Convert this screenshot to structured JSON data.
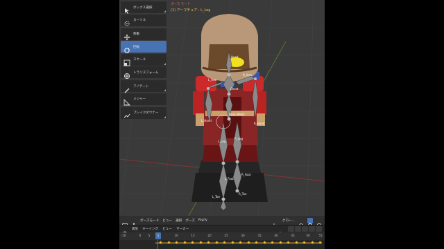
{
  "viewport": {
    "mode_text": "ポーズ モード",
    "object_text": "(1) アーマチュア : L_Leg"
  },
  "toolbar": {
    "items": [
      {
        "label": "ボックス選択",
        "icon": "box-select-icon",
        "active": false
      },
      {
        "label": "カーソル",
        "icon": "cursor-icon",
        "active": false
      },
      {
        "label": "移動",
        "icon": "move-icon",
        "active": false
      },
      {
        "label": "回転",
        "icon": "rotate-icon",
        "active": true
      },
      {
        "label": "スケール",
        "icon": "scale-icon",
        "active": false
      },
      {
        "label": "トランスフォーム",
        "icon": "transform-icon",
        "active": false
      },
      {
        "label": "アノテート",
        "icon": "annotate-icon",
        "active": false
      },
      {
        "label": "メジャー",
        "icon": "measure-icon",
        "active": false
      },
      {
        "label": "ブレイクダウナー",
        "icon": "breakdowner-icon",
        "active": false
      }
    ]
  },
  "bones": {
    "head": "Head",
    "l_arm": "L_Arm",
    "r_arm": "R_Arm",
    "chest": "Chest",
    "waist": "Base_Waist",
    "l_hand": "L_Hand",
    "r_hand": "R_Hand",
    "l_leg": "L_Leg",
    "r_leg": "R_Leg",
    "l_foot": "L_Foot",
    "r_foot": "R_Foot",
    "l_toe": "L_Toe",
    "r_toe": "R_Toe"
  },
  "header": {
    "mode": "ポーズモード",
    "menus": [
      "ビュー",
      "選択",
      "ポーズ",
      "Rigify"
    ],
    "transform_orientation": "グロー..."
  },
  "timeline": {
    "menus": [
      "再生",
      "キーイング",
      "ビュー",
      "マーカー"
    ],
    "current_frame": "1",
    "ticks": [
      "-10",
      "0",
      "5",
      "10",
      "15",
      "20",
      "25",
      "30",
      "35",
      "40",
      "45",
      "50",
      "55"
    ]
  },
  "colors": {
    "accent": "#4772b3",
    "keyframe": "#f0b020",
    "mode_text": "#e06060",
    "object_text": "#e0c060"
  }
}
